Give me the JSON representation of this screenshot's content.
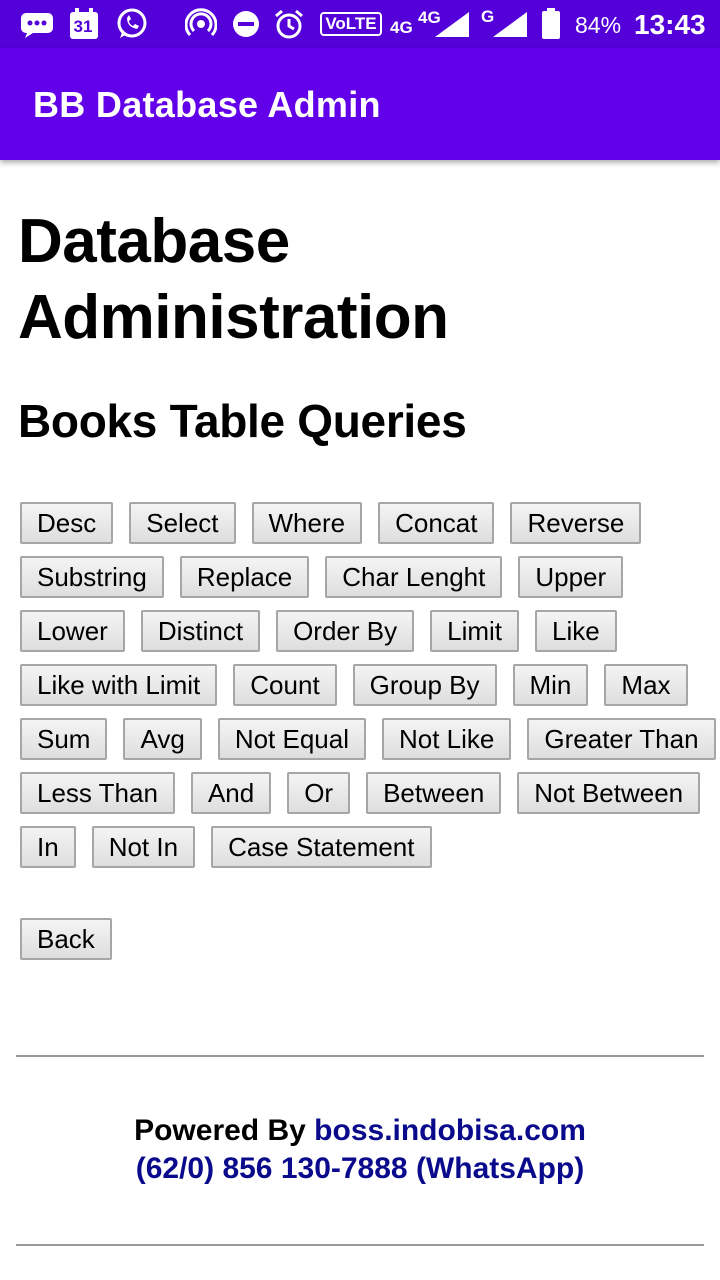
{
  "status_bar": {
    "calendar_day": "31",
    "network_volte": "VoLTE",
    "network_4g_small": "4G",
    "network_4g": "4G",
    "network_g": "G",
    "battery": "84%",
    "time": "13:43"
  },
  "app_bar": {
    "title": "BB Database Admin"
  },
  "page": {
    "title": "Database Administration",
    "subtitle": "Books Table Queries"
  },
  "query_rows": [
    [
      "Desc",
      "Select",
      "Where",
      "Concat",
      "Reverse"
    ],
    [
      "Substring",
      "Replace",
      "Char Lenght",
      "Upper"
    ],
    [
      "Lower",
      "Distinct",
      "Order By",
      "Limit",
      "Like"
    ],
    [
      "Like with Limit",
      "Count",
      "Group By",
      "Min",
      "Max"
    ],
    [
      "Sum",
      "Avg",
      "Not Equal",
      "Not Like",
      "Greater Than"
    ],
    [
      "Less Than",
      "And",
      "Or",
      "Between",
      "Not Between"
    ],
    [
      "In",
      "Not In",
      "Case Statement"
    ]
  ],
  "back_label": "Back",
  "footer": {
    "powered_by": "Powered By",
    "site_link": "boss.indobisa.com",
    "phone_link": "(62/0) 856 130-7888 (WhatsApp)"
  },
  "colors": {
    "status_bar": "#5300d9",
    "app_bar": "#6200ea",
    "link": "#0a0a8c"
  }
}
